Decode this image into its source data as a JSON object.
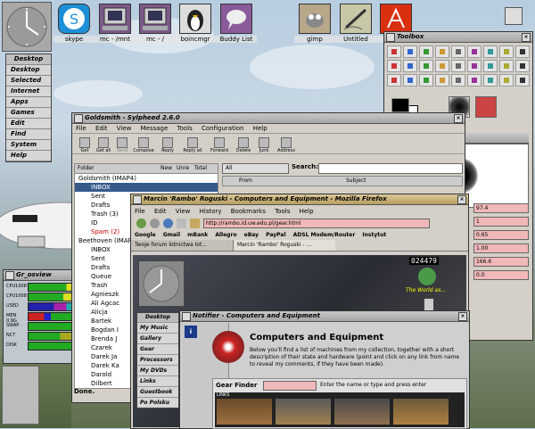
{
  "desktop_icons": [
    {
      "label": "skype",
      "icon": "skype-icon",
      "color": "#1d8fd6"
    },
    {
      "label": "mc - /mnt",
      "icon": "monitor-icon",
      "color": "#7a5a8a"
    },
    {
      "label": "mc - /",
      "icon": "monitor-icon",
      "color": "#7a5a8a"
    },
    {
      "label": "boincmgr",
      "icon": "tux-icon",
      "color": "#222222"
    },
    {
      "label": "Buddy List",
      "icon": "chat-icon",
      "color": "#8a5a9a"
    },
    {
      "label": "gimp",
      "icon": "gimp-icon",
      "color": "#8a7a5a"
    },
    {
      "label": "Untitled",
      "icon": "drawing-icon",
      "color": "#8a8a5a"
    },
    {
      "label": "Acrobat",
      "icon": "acrobat-icon",
      "color": "#d83010"
    }
  ],
  "left_menu": {
    "title": "Desktop",
    "items": [
      "Desktop",
      "Selected",
      "Internet",
      "Apps",
      "Games",
      "Edit",
      "Find",
      "System",
      "Help"
    ]
  },
  "osview": {
    "title": "Gr_osview",
    "rows": [
      "CPU1008",
      "CPU1008",
      "USED",
      "MEN 0.9G",
      "SWAP",
      "NCT",
      "DISK"
    ]
  },
  "sylpheed": {
    "title": "Goldsmith - Sylpheed 2.6.0",
    "menu": [
      "File",
      "Edit",
      "View",
      "Message",
      "Tools",
      "Configuration",
      "Help"
    ],
    "toolbar": [
      "Get",
      "Get all",
      "Send",
      "Compose",
      "Reply",
      "Reply all",
      "Forward",
      "Delete",
      "Junk",
      "Address"
    ],
    "folder_header": "Folder",
    "col_new": "New",
    "col_unread": "Unre",
    "col_total": "Total",
    "filter": "All",
    "search_label": "Search:",
    "msg_cols": [
      "From",
      "Subject"
    ],
    "folders": [
      {
        "name": "Goldsmith (IMAP4)",
        "indent": 0
      },
      {
        "name": "INBOX",
        "indent": 1,
        "selected": true
      },
      {
        "name": "Sent",
        "indent": 1
      },
      {
        "name": "Drafts",
        "indent": 1
      },
      {
        "name": "Trash (3)",
        "indent": 1
      },
      {
        "name": "ID",
        "indent": 1
      },
      {
        "name": "Spam (2)",
        "indent": 1,
        "red": true
      },
      {
        "name": "Beethoven (IMAP4)",
        "indent": 0
      },
      {
        "name": "INBOX",
        "indent": 1
      },
      {
        "name": "Sent",
        "indent": 1
      },
      {
        "name": "Drafts",
        "indent": 1
      },
      {
        "name": "Queue",
        "indent": 1
      },
      {
        "name": "Trash",
        "indent": 1
      },
      {
        "name": "Agnieszk",
        "indent": 1
      },
      {
        "name": "Ali Agcac",
        "indent": 1
      },
      {
        "name": "Alicja",
        "indent": 1
      },
      {
        "name": "Bartek",
        "indent": 1
      },
      {
        "name": "Bogdan I",
        "indent": 1
      },
      {
        "name": "Brenda J",
        "indent": 1
      },
      {
        "name": "Czarek",
        "indent": 1
      },
      {
        "name": "Darek Ja",
        "indent": 1
      },
      {
        "name": "Darek Ka",
        "indent": 1
      },
      {
        "name": "Darold",
        "indent": 1
      },
      {
        "name": "Dilbert",
        "indent": 1
      }
    ],
    "status": "Done."
  },
  "firefox": {
    "title": "Marcin 'Rambo' Roguski - Computers and Equipment - Mozilla Firefox",
    "menu": [
      "File",
      "Edit",
      "View",
      "History",
      "Bookmarks",
      "Tools",
      "Help"
    ],
    "url": "http://rambo.id.uw.edu.pl/gear.html",
    "bookmarks": [
      "Google",
      "Gmail",
      "mBank",
      "Allegro",
      "eBay",
      "PayPal",
      "ADSL Modem/Router",
      "Instytut"
    ],
    "tabs": [
      "Twoje forum lotnictwa lot...",
      "Marcin 'Rambo' Roguski - ..."
    ],
    "counter": "024479",
    "globe_caption": "The World as...",
    "side_menu": {
      "title": "Desktop",
      "items": [
        "My Music",
        "Gallery",
        "Gear",
        "Processors",
        "My DVDs",
        "Links",
        "Guestbook",
        "Po Polsku"
      ]
    }
  },
  "notifier": {
    "title": "Notifier - Computers and Equipment",
    "heading": "Computers and Equipment",
    "body": "Below you'll find a list of machines from my collection, together with a short description of their state and hardware (point and click on any link from name to reveal my comments, if they have been made).",
    "finder_label": "Gear Finder",
    "finder_hint": "Enter the name or type and press enter",
    "links_label": "LINKS"
  },
  "toolbox": {
    "title": "Toolbox",
    "brush_editor": "Brush Editor",
    "values": [
      "97.4",
      "1",
      "0.65",
      "1.00",
      "166.6",
      "0.0"
    ]
  }
}
